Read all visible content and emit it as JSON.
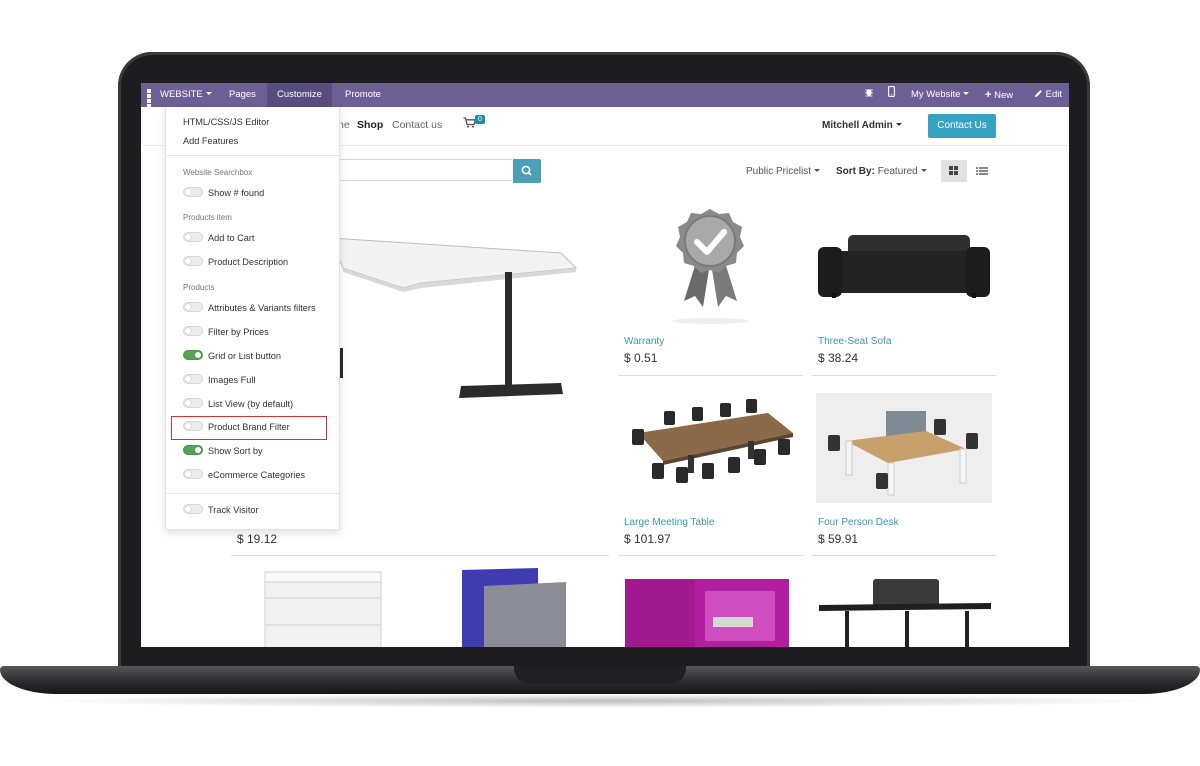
{
  "admin_bar": {
    "app_label": "WEBSITE",
    "menus": [
      "Pages",
      "Customize",
      "Promote"
    ],
    "right": {
      "site": "My Website",
      "new": "New",
      "edit": "Edit"
    }
  },
  "header": {
    "nav": {
      "home_fragment": "ne",
      "shop": "Shop",
      "contact": "Contact us"
    },
    "cart_count": "0",
    "user": "Mitchell Admin",
    "contact_button": "Contact Us"
  },
  "toolbar": {
    "pricelist": "Public Pricelist",
    "sort_label": "Sort By:",
    "sort_value": "Featured"
  },
  "customize_menu": {
    "items": [
      "HTML/CSS/JS Editor",
      "Add Features"
    ],
    "sections": [
      {
        "header": "Website Searchbox",
        "options": [
          {
            "label": "Show # found",
            "on": false
          }
        ]
      },
      {
        "header": "Products item",
        "options": [
          {
            "label": "Add to Cart",
            "on": false
          },
          {
            "label": "Product Description",
            "on": false
          }
        ]
      },
      {
        "header": "Products",
        "options": [
          {
            "label": "Attributes & Variants filters",
            "on": false
          },
          {
            "label": "Filter by Prices",
            "on": false
          },
          {
            "label": "Grid or List button",
            "on": true
          },
          {
            "label": "Images Full",
            "on": false
          },
          {
            "label": "List View (by default)",
            "on": false
          },
          {
            "label": "Product Brand Filter",
            "on": false
          },
          {
            "label": "Show Sort by",
            "on": true
          },
          {
            "label": "eCommerce Categories",
            "on": false
          }
        ]
      }
    ],
    "footer_option": {
      "label": "Track Visitor",
      "on": false
    }
  },
  "products": [
    {
      "name": "",
      "price": "$ 19.12"
    },
    {
      "name": "Warranty",
      "price": "$ 0.51"
    },
    {
      "name": "Three-Seat Sofa",
      "price": "$ 38.24"
    },
    {
      "name": "Large Meeting Table",
      "price": "$ 101.97"
    },
    {
      "name": "Four Person Desk",
      "price": "$ 59.91"
    }
  ],
  "colors": {
    "navbar": "#6d5e96",
    "accent": "#35a3c1",
    "link": "#3f94b0",
    "toggle_on": "#54a454",
    "highlight": "#d3343a"
  }
}
